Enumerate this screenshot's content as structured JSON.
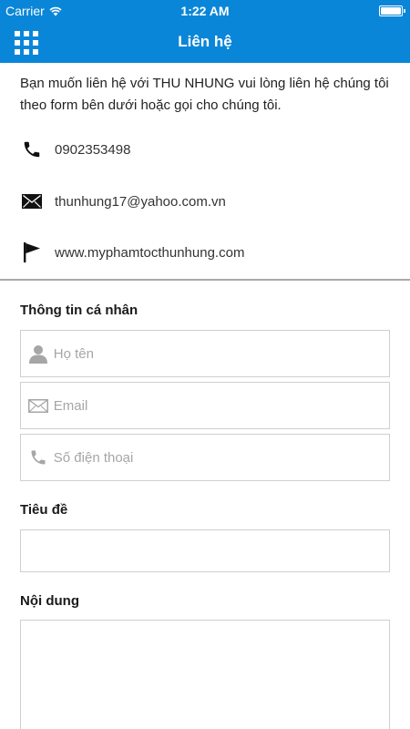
{
  "status_bar": {
    "carrier": "Carrier",
    "time": "1:22 AM"
  },
  "nav": {
    "title": "Liên hệ",
    "menu_icon": "grid-menu-icon"
  },
  "intro": {
    "text": "Bạn muốn liên hệ với THU NHUNG vui lòng liên hệ chúng tôi theo form bên dưới hoặc gọi cho chúng tôi."
  },
  "contacts": {
    "phone": {
      "icon": "phone-icon",
      "value": "0902353498"
    },
    "email": {
      "icon": "envelope-icon",
      "value": "thunhung17@yahoo.com.vn"
    },
    "website": {
      "icon": "flag-icon",
      "value": "www.myphamtocthunhung.com"
    }
  },
  "form": {
    "personal_label": "Thông tin cá nhân",
    "name_placeholder": "Họ tên",
    "email_placeholder": "Email",
    "phone_placeholder": "Số điện thoại",
    "subject_label": "Tiêu đề",
    "subject_value": "",
    "content_label": "Nội dung",
    "content_value": ""
  },
  "colors": {
    "primary": "#0a86d8",
    "divider": "#a9a9a9",
    "field_border": "#cfcfcf",
    "placeholder": "#a6a6a6"
  }
}
